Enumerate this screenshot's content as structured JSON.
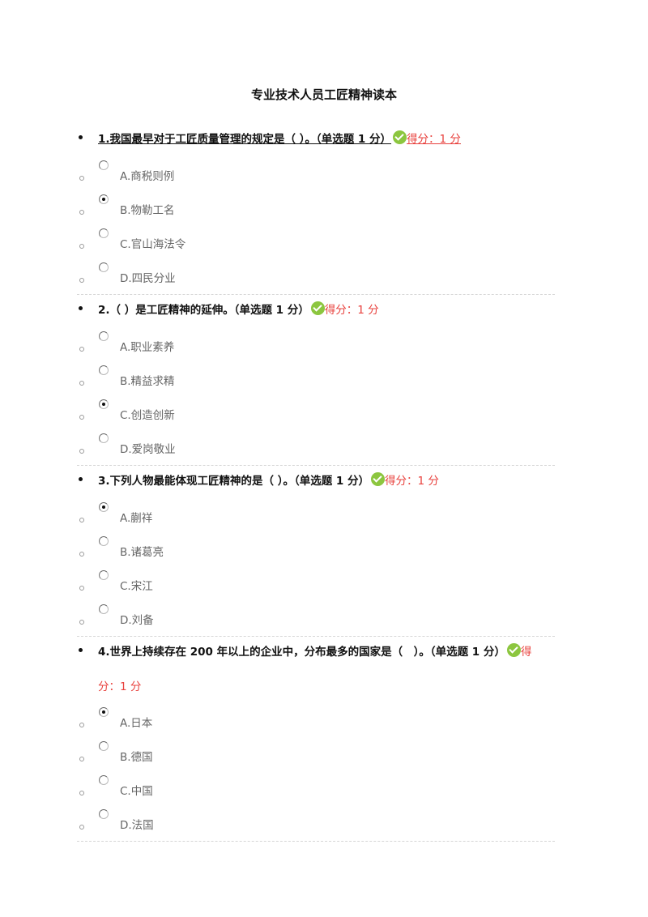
{
  "document": {
    "title": "专业技术人员工匠精神读本"
  },
  "questions": [
    {
      "text": "1.我国最早对于工匠质量管理的规定是（ ）。（单选题 1 分）",
      "score": "得分：1 分",
      "status_icon": "check-circle-icon",
      "options": [
        {
          "label": "A.商税则例",
          "selected": false
        },
        {
          "label": "B.物勒工名",
          "selected": true
        },
        {
          "label": "C.官山海法令",
          "selected": false
        },
        {
          "label": "D.四民分业",
          "selected": false
        }
      ]
    },
    {
      "text": "2.（ ）是工匠精神的延伸。（单选题 1 分）",
      "score": "得分：1 分",
      "status_icon": "check-circle-icon",
      "options": [
        {
          "label": "A.职业素养",
          "selected": false
        },
        {
          "label": "B.精益求精",
          "selected": false
        },
        {
          "label": "C.创造创新",
          "selected": true
        },
        {
          "label": "D.爱岗敬业",
          "selected": false
        }
      ]
    },
    {
      "text": "3.下列人物最能体现工匠精神的是（ ）。（单选题 1 分）",
      "score": "得分：1 分",
      "status_icon": "check-circle-icon",
      "options": [
        {
          "label": "A.蒯祥",
          "selected": true
        },
        {
          "label": "B.诸葛亮",
          "selected": false
        },
        {
          "label": "C.宋江",
          "selected": false
        },
        {
          "label": "D.刘备",
          "selected": false
        }
      ]
    },
    {
      "text": "4.世界上持续存在 200 年以上的企业中，分布最多的国家是（　）。（单选题 1 分）",
      "score_part1": "得",
      "score_part2": "分：1 分",
      "status_icon": "check-circle-icon",
      "options": [
        {
          "label": "A.日本",
          "selected": true
        },
        {
          "label": "B.德国",
          "selected": false
        },
        {
          "label": "C.中国",
          "selected": false
        },
        {
          "label": "D.法国",
          "selected": false
        }
      ]
    }
  ],
  "colors": {
    "correct": "#8cc63f",
    "score": "#e8413d",
    "option_text": "#666666"
  }
}
